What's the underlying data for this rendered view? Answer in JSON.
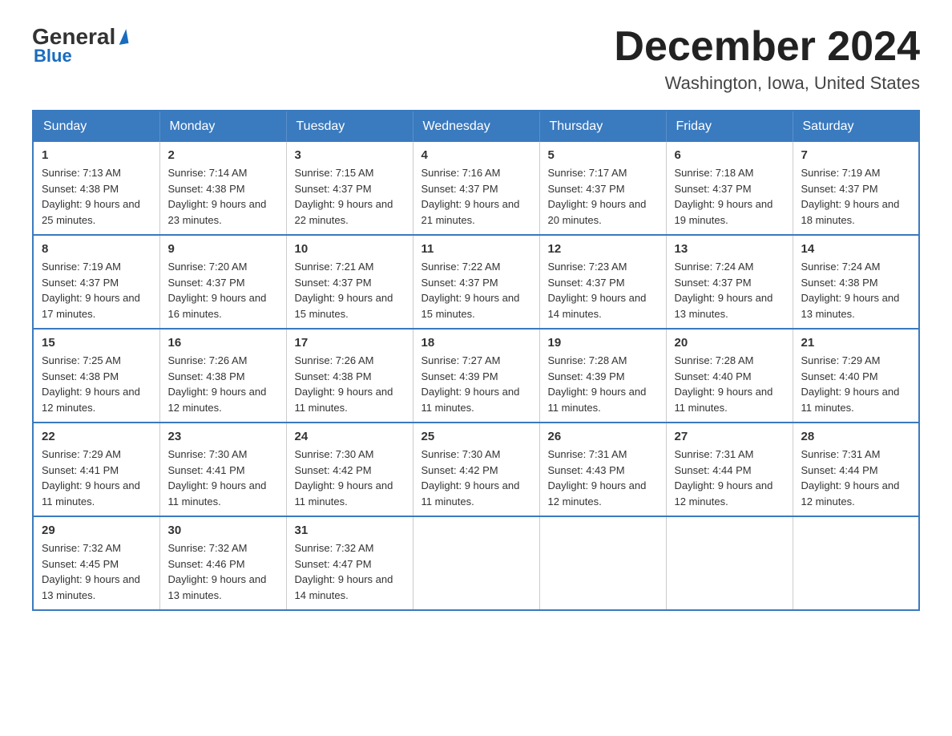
{
  "logo": {
    "general_text": "General",
    "blue_text": "Blue"
  },
  "header": {
    "month_title": "December 2024",
    "location": "Washington, Iowa, United States"
  },
  "days_of_week": [
    "Sunday",
    "Monday",
    "Tuesday",
    "Wednesday",
    "Thursday",
    "Friday",
    "Saturday"
  ],
  "weeks": [
    [
      {
        "day": "1",
        "sunrise": "7:13 AM",
        "sunset": "4:38 PM",
        "daylight": "9 hours and 25 minutes."
      },
      {
        "day": "2",
        "sunrise": "7:14 AM",
        "sunset": "4:38 PM",
        "daylight": "9 hours and 23 minutes."
      },
      {
        "day": "3",
        "sunrise": "7:15 AM",
        "sunset": "4:37 PM",
        "daylight": "9 hours and 22 minutes."
      },
      {
        "day": "4",
        "sunrise": "7:16 AM",
        "sunset": "4:37 PM",
        "daylight": "9 hours and 21 minutes."
      },
      {
        "day": "5",
        "sunrise": "7:17 AM",
        "sunset": "4:37 PM",
        "daylight": "9 hours and 20 minutes."
      },
      {
        "day": "6",
        "sunrise": "7:18 AM",
        "sunset": "4:37 PM",
        "daylight": "9 hours and 19 minutes."
      },
      {
        "day": "7",
        "sunrise": "7:19 AM",
        "sunset": "4:37 PM",
        "daylight": "9 hours and 18 minutes."
      }
    ],
    [
      {
        "day": "8",
        "sunrise": "7:19 AM",
        "sunset": "4:37 PM",
        "daylight": "9 hours and 17 minutes."
      },
      {
        "day": "9",
        "sunrise": "7:20 AM",
        "sunset": "4:37 PM",
        "daylight": "9 hours and 16 minutes."
      },
      {
        "day": "10",
        "sunrise": "7:21 AM",
        "sunset": "4:37 PM",
        "daylight": "9 hours and 15 minutes."
      },
      {
        "day": "11",
        "sunrise": "7:22 AM",
        "sunset": "4:37 PM",
        "daylight": "9 hours and 15 minutes."
      },
      {
        "day": "12",
        "sunrise": "7:23 AM",
        "sunset": "4:37 PM",
        "daylight": "9 hours and 14 minutes."
      },
      {
        "day": "13",
        "sunrise": "7:24 AM",
        "sunset": "4:37 PM",
        "daylight": "9 hours and 13 minutes."
      },
      {
        "day": "14",
        "sunrise": "7:24 AM",
        "sunset": "4:38 PM",
        "daylight": "9 hours and 13 minutes."
      }
    ],
    [
      {
        "day": "15",
        "sunrise": "7:25 AM",
        "sunset": "4:38 PM",
        "daylight": "9 hours and 12 minutes."
      },
      {
        "day": "16",
        "sunrise": "7:26 AM",
        "sunset": "4:38 PM",
        "daylight": "9 hours and 12 minutes."
      },
      {
        "day": "17",
        "sunrise": "7:26 AM",
        "sunset": "4:38 PM",
        "daylight": "9 hours and 11 minutes."
      },
      {
        "day": "18",
        "sunrise": "7:27 AM",
        "sunset": "4:39 PM",
        "daylight": "9 hours and 11 minutes."
      },
      {
        "day": "19",
        "sunrise": "7:28 AM",
        "sunset": "4:39 PM",
        "daylight": "9 hours and 11 minutes."
      },
      {
        "day": "20",
        "sunrise": "7:28 AM",
        "sunset": "4:40 PM",
        "daylight": "9 hours and 11 minutes."
      },
      {
        "day": "21",
        "sunrise": "7:29 AM",
        "sunset": "4:40 PM",
        "daylight": "9 hours and 11 minutes."
      }
    ],
    [
      {
        "day": "22",
        "sunrise": "7:29 AM",
        "sunset": "4:41 PM",
        "daylight": "9 hours and 11 minutes."
      },
      {
        "day": "23",
        "sunrise": "7:30 AM",
        "sunset": "4:41 PM",
        "daylight": "9 hours and 11 minutes."
      },
      {
        "day": "24",
        "sunrise": "7:30 AM",
        "sunset": "4:42 PM",
        "daylight": "9 hours and 11 minutes."
      },
      {
        "day": "25",
        "sunrise": "7:30 AM",
        "sunset": "4:42 PM",
        "daylight": "9 hours and 11 minutes."
      },
      {
        "day": "26",
        "sunrise": "7:31 AM",
        "sunset": "4:43 PM",
        "daylight": "9 hours and 12 minutes."
      },
      {
        "day": "27",
        "sunrise": "7:31 AM",
        "sunset": "4:44 PM",
        "daylight": "9 hours and 12 minutes."
      },
      {
        "day": "28",
        "sunrise": "7:31 AM",
        "sunset": "4:44 PM",
        "daylight": "9 hours and 12 minutes."
      }
    ],
    [
      {
        "day": "29",
        "sunrise": "7:32 AM",
        "sunset": "4:45 PM",
        "daylight": "9 hours and 13 minutes."
      },
      {
        "day": "30",
        "sunrise": "7:32 AM",
        "sunset": "4:46 PM",
        "daylight": "9 hours and 13 minutes."
      },
      {
        "day": "31",
        "sunrise": "7:32 AM",
        "sunset": "4:47 PM",
        "daylight": "9 hours and 14 minutes."
      },
      null,
      null,
      null,
      null
    ]
  ],
  "labels": {
    "sunrise_prefix": "Sunrise: ",
    "sunset_prefix": "Sunset: ",
    "daylight_prefix": "Daylight: "
  }
}
